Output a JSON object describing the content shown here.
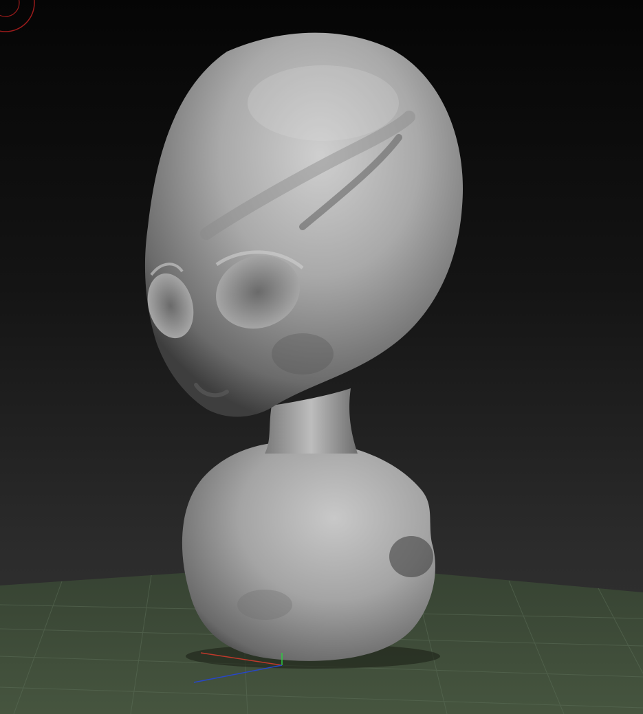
{
  "viewport": {
    "background_top": "#050505",
    "background_bottom": "#333333",
    "floor_color": "#3d4a3c",
    "grid_line_color": "#5c6e58",
    "model_color": "#b3b3b3"
  },
  "gizmo": {
    "x_axis_color": "#c0392b",
    "y_axis_color": "#2ecc40",
    "z_axis_color": "#2746c8"
  },
  "corner_widget": {
    "ring_color": "#9b1b1b"
  },
  "model": {
    "icon": "sculpted-alien-bust"
  }
}
